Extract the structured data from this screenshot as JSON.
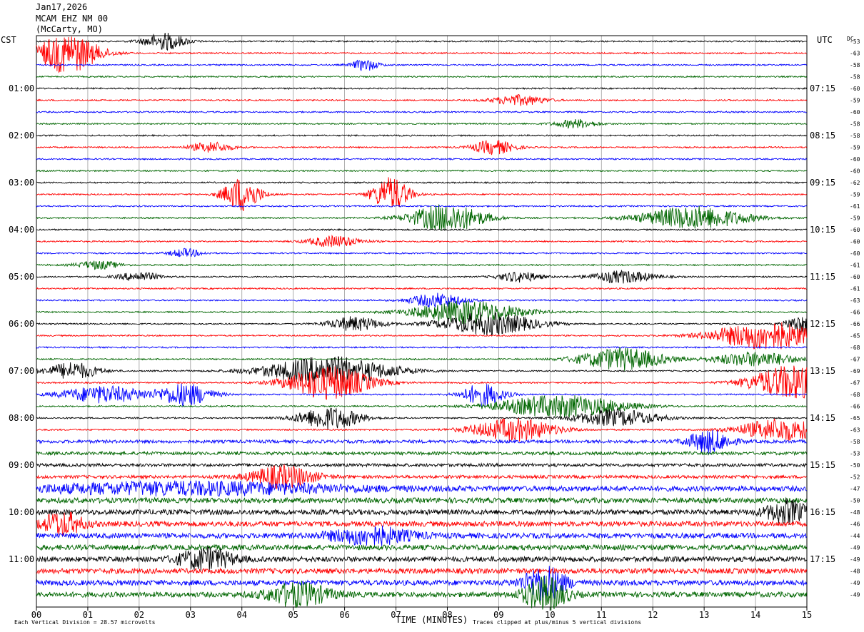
{
  "header": {
    "date": "Jan17,2026",
    "station": "MCAM EHZ NM 00",
    "location": "(McCarty, MO)"
  },
  "left_zone": "CST",
  "right_zone": "UTC",
  "dc_label": "DC",
  "footer": {
    "scale_note": "Each Vertical Division =   28.57 microvolts",
    "xlabel": "TIME (MINUTES)",
    "clip_note": "Traces clipped at plus/minus 5 vertical divisions"
  },
  "colors": {
    "trace_cycle": [
      "#000000",
      "#ff0000",
      "#0000ff",
      "#006600"
    ],
    "grid": "#9a9a9a",
    "background": "#ffffff"
  },
  "chart_data": {
    "type": "line",
    "title": "MCAM EHZ NM 00",
    "xlabel": "TIME (MINUTES)",
    "xlim": [
      0,
      15
    ],
    "x_ticks": [
      "00",
      "01",
      "02",
      "03",
      "04",
      "05",
      "06",
      "07",
      "08",
      "09",
      "10",
      "11",
      "12",
      "13",
      "14",
      "15"
    ],
    "trace_interval_minutes": 15,
    "trace_count": 48,
    "left_hour_labels": [
      "01:00",
      "02:00",
      "03:00",
      "04:00",
      "05:00",
      "06:00",
      "07:00",
      "08:00",
      "09:00",
      "10:00",
      "11:00"
    ],
    "right_hour_labels": [
      "07:15",
      "08:15",
      "09:15",
      "10:15",
      "11:15",
      "12:15",
      "13:15",
      "14:15",
      "15:15",
      "16:15",
      "17:15"
    ],
    "dc_offsets": [
      -53,
      -63,
      -58,
      -58,
      -60,
      -59,
      -60,
      -58,
      -58,
      -59,
      -60,
      -60,
      -62,
      -59,
      -61,
      -59,
      -60,
      -60,
      -60,
      -61,
      -60,
      -61,
      -63,
      -66,
      -66,
      -65,
      -68,
      -67,
      -69,
      -67,
      -68,
      -66,
      -65,
      -63,
      -58,
      -53,
      -50,
      -52,
      -47,
      -50,
      -48,
      -46,
      -44,
      -49,
      -49,
      -48,
      -49,
      -49
    ],
    "events": [
      {
        "trace": 1,
        "minute": 0.6,
        "width": 0.6,
        "amp": 7
      },
      {
        "trace": 0,
        "minute": 2.5,
        "width": 0.4,
        "amp": 3
      },
      {
        "trace": 2,
        "minute": 6.4,
        "width": 0.25,
        "amp": 2
      },
      {
        "trace": 5,
        "minute": 9.4,
        "width": 0.5,
        "amp": 1.8
      },
      {
        "trace": 7,
        "minute": 10.5,
        "width": 0.4,
        "amp": 1.5
      },
      {
        "trace": 9,
        "minute": 3.4,
        "width": 0.4,
        "amp": 1.8
      },
      {
        "trace": 9,
        "minute": 8.9,
        "width": 0.4,
        "amp": 2.5
      },
      {
        "trace": 13,
        "minute": 4.0,
        "width": 0.35,
        "amp": 6
      },
      {
        "trace": 13,
        "minute": 6.9,
        "width": 0.35,
        "amp": 6
      },
      {
        "trace": 15,
        "minute": 8.0,
        "width": 0.7,
        "amp": 5
      },
      {
        "trace": 15,
        "minute": 12.8,
        "width": 1.0,
        "amp": 4
      },
      {
        "trace": 17,
        "minute": 5.8,
        "width": 0.5,
        "amp": 2
      },
      {
        "trace": 18,
        "minute": 2.9,
        "width": 0.3,
        "amp": 1.5
      },
      {
        "trace": 19,
        "minute": 1.2,
        "width": 0.4,
        "amp": 1.5
      },
      {
        "trace": 20,
        "minute": 2.0,
        "width": 0.4,
        "amp": 1.6
      },
      {
        "trace": 20,
        "minute": 9.4,
        "width": 0.4,
        "amp": 1.8
      },
      {
        "trace": 20,
        "minute": 11.4,
        "width": 0.6,
        "amp": 2.2
      },
      {
        "trace": 22,
        "minute": 7.8,
        "width": 0.5,
        "amp": 2.5
      },
      {
        "trace": 23,
        "minute": 8.4,
        "width": 1.0,
        "amp": 4
      },
      {
        "trace": 24,
        "minute": 6.2,
        "width": 0.5,
        "amp": 2.5
      },
      {
        "trace": 24,
        "minute": 8.8,
        "width": 0.9,
        "amp": 4
      },
      {
        "trace": 24,
        "minute": 14.9,
        "width": 0.3,
        "amp": 3
      },
      {
        "trace": 25,
        "minute": 14.2,
        "width": 1.0,
        "amp": 5
      },
      {
        "trace": 27,
        "minute": 11.4,
        "width": 0.8,
        "amp": 4
      },
      {
        "trace": 27,
        "minute": 14.0,
        "width": 0.8,
        "amp": 2.5
      },
      {
        "trace": 28,
        "minute": 5.7,
        "width": 1.2,
        "amp": 5
      },
      {
        "trace": 28,
        "minute": 0.7,
        "width": 0.5,
        "amp": 3
      },
      {
        "trace": 29,
        "minute": 14.7,
        "width": 0.8,
        "amp": 6
      },
      {
        "trace": 29,
        "minute": 5.7,
        "width": 0.8,
        "amp": 6
      },
      {
        "trace": 30,
        "minute": 1.3,
        "width": 0.8,
        "amp": 3
      },
      {
        "trace": 30,
        "minute": 2.9,
        "width": 0.5,
        "amp": 4
      },
      {
        "trace": 30,
        "minute": 8.7,
        "width": 0.4,
        "amp": 4
      },
      {
        "trace": 31,
        "minute": 10.2,
        "width": 1.2,
        "amp": 4
      },
      {
        "trace": 32,
        "minute": 5.7,
        "width": 0.6,
        "amp": 4
      },
      {
        "trace": 32,
        "minute": 11.3,
        "width": 0.8,
        "amp": 3
      },
      {
        "trace": 33,
        "minute": 9.3,
        "width": 0.8,
        "amp": 4
      },
      {
        "trace": 33,
        "minute": 14.5,
        "width": 0.8,
        "amp": 4
      },
      {
        "trace": 34,
        "minute": 13.1,
        "width": 0.4,
        "amp": 4
      },
      {
        "trace": 37,
        "minute": 4.8,
        "width": 0.6,
        "amp": 4
      },
      {
        "trace": 38,
        "minute": 3.0,
        "width": 3.0,
        "amp": 2
      },
      {
        "trace": 40,
        "minute": 14.6,
        "width": 0.4,
        "amp": 4
      },
      {
        "trace": 41,
        "minute": 0.5,
        "width": 0.4,
        "amp": 4
      },
      {
        "trace": 42,
        "minute": 6.5,
        "width": 0.8,
        "amp": 3
      },
      {
        "trace": 44,
        "minute": 3.3,
        "width": 0.5,
        "amp": 4
      },
      {
        "trace": 46,
        "minute": 9.9,
        "width": 0.4,
        "amp": 6
      },
      {
        "trace": 47,
        "minute": 9.9,
        "width": 0.4,
        "amp": 6
      },
      {
        "trace": 47,
        "minute": 5.1,
        "width": 0.6,
        "amp": 4
      }
    ]
  }
}
